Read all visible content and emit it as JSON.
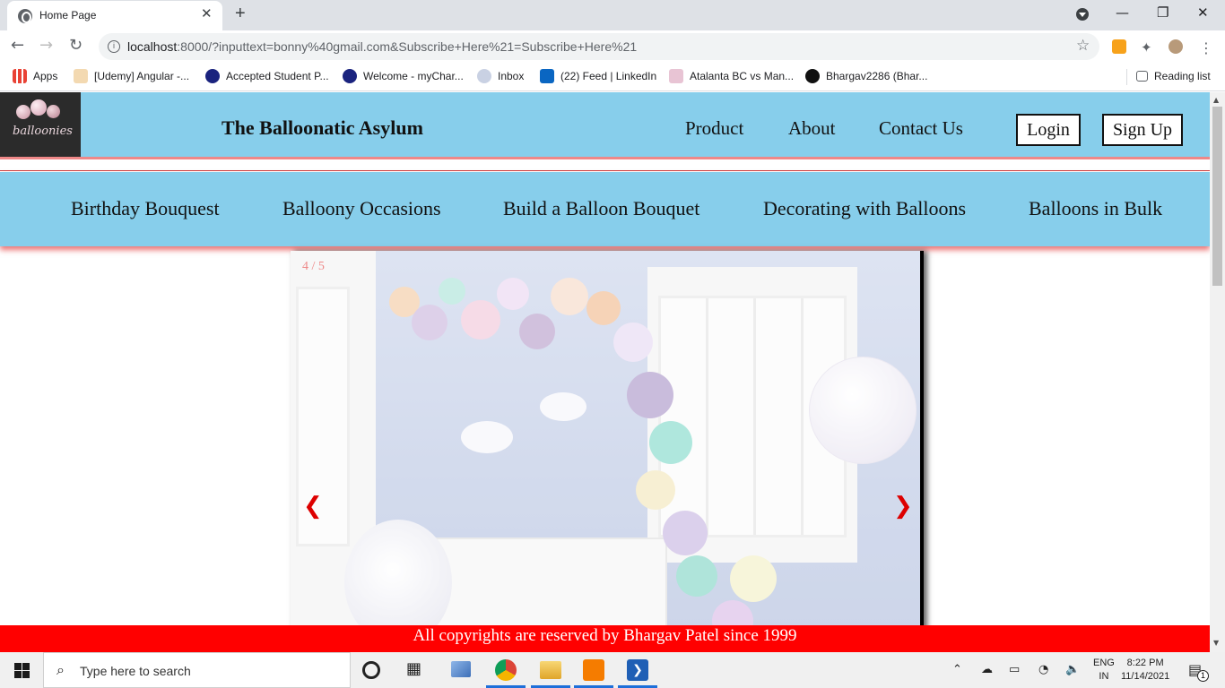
{
  "browser": {
    "tab_title": "Home Page",
    "tab_close": "✕",
    "new_tab": "+",
    "url_host": "localhost",
    "url_rest": ":8000/?inputtext=bonny%40gmail.com&Subscribe+Here%21=Subscribe+Here%21",
    "window_controls": [
      "—",
      "❐",
      "✕"
    ],
    "bookmarks": [
      {
        "label": "Apps",
        "icon": "apps-grid-icon",
        "color": "#e94235"
      },
      {
        "label": "[Udemy] Angular -...",
        "icon": "udemy-icon",
        "color": "#a435f0"
      },
      {
        "label": "Accepted Student P...",
        "icon": "compass-icon",
        "color": "#1a237e"
      },
      {
        "label": "Welcome - myChar...",
        "icon": "compass-icon",
        "color": "#1a237e"
      },
      {
        "label": "Inbox",
        "icon": "seal-icon",
        "color": "#7a8fb5"
      },
      {
        "label": "(22) Feed | LinkedIn",
        "icon": "linkedin-icon",
        "color": "#0a66c2"
      },
      {
        "label": "Atalanta BC vs Man...",
        "icon": "sport-icon",
        "color": "#c2185b"
      },
      {
        "label": "Bhargav2286 (Bhar...",
        "icon": "github-icon",
        "color": "#111111"
      }
    ],
    "reading_list": "Reading list"
  },
  "site": {
    "title": "The Balloonatic Asylum",
    "logo_text": "balloonies",
    "nav": [
      "Product",
      "About",
      "Contact Us"
    ],
    "login": "Login",
    "signup": "Sign Up",
    "categories": [
      "Birthday Bouquest",
      "Balloony Occasions",
      "Build a Balloon Bouquet",
      "Decorating with Balloons",
      "Balloons in Bulk"
    ],
    "slideshow": {
      "counter": "4 / 5",
      "prev": "❮",
      "next": "❯"
    },
    "footer": "All copyrights are reserved by Bhargav Patel since 1999"
  },
  "colors": {
    "header_bg": "#87ceeb",
    "footer_bg": "#ff0000",
    "arrow": "#dd0000"
  },
  "taskbar": {
    "search_placeholder": "Type here to search",
    "lang_top": "ENG",
    "lang_bottom": "IN",
    "time": "8:22 PM",
    "date": "11/14/2021",
    "notification_count": "1"
  }
}
